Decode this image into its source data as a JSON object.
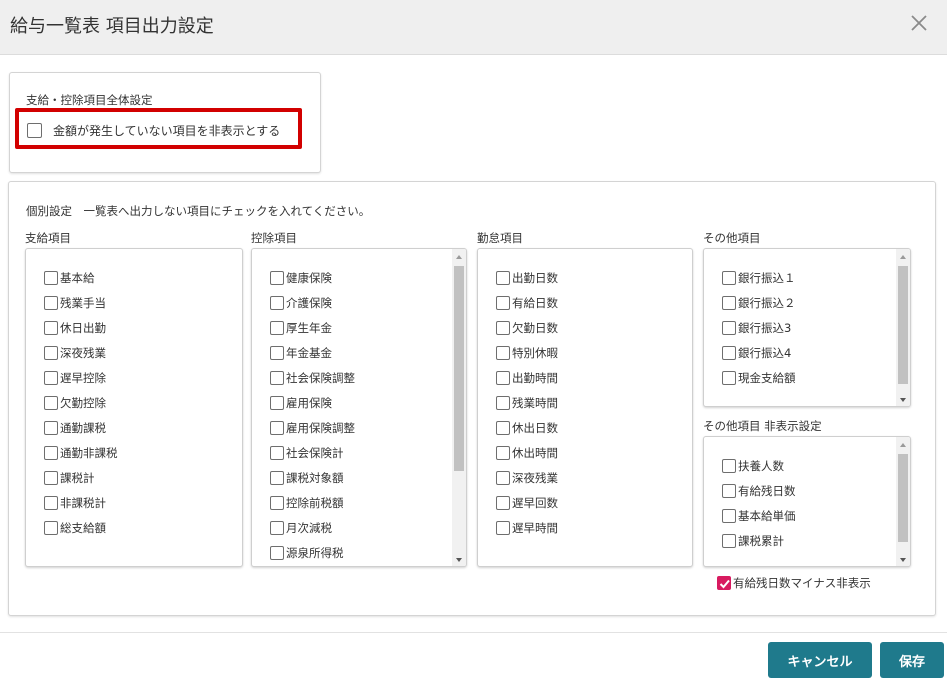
{
  "dialog": {
    "title": "給与一覧表 項目出力設定",
    "close_icon": "close-icon"
  },
  "global_settings": {
    "title": "支給・控除項目全体設定",
    "hide_zero": {
      "label": "金額が発生していない項目を非表示とする",
      "checked": false
    }
  },
  "individual_settings": {
    "title": "個別設定　一覧表へ出力しない項目にチェックを入れてください。",
    "payment": {
      "title": "支給項目",
      "items": [
        {
          "label": "基本給"
        },
        {
          "label": "残業手当"
        },
        {
          "label": "休日出勤"
        },
        {
          "label": "深夜残業"
        },
        {
          "label": "遅早控除"
        },
        {
          "label": "欠勤控除"
        },
        {
          "label": "通勤課税"
        },
        {
          "label": "通勤非課税"
        },
        {
          "label": "課税計"
        },
        {
          "label": "非課税計"
        },
        {
          "label": "総支給額"
        }
      ]
    },
    "deduction": {
      "title": "控除項目",
      "items": [
        {
          "label": "健康保険"
        },
        {
          "label": "介護保険"
        },
        {
          "label": "厚生年金"
        },
        {
          "label": "年金基金"
        },
        {
          "label": "社会保険調整"
        },
        {
          "label": "雇用保険"
        },
        {
          "label": "雇用保険調整"
        },
        {
          "label": "社会保険計"
        },
        {
          "label": "課税対象額"
        },
        {
          "label": "控除前税額"
        },
        {
          "label": "月次減税"
        },
        {
          "label": "源泉所得税"
        }
      ]
    },
    "attendance": {
      "title": "勤怠項目",
      "items": [
        {
          "label": "出勤日数"
        },
        {
          "label": "有給日数"
        },
        {
          "label": "欠勤日数"
        },
        {
          "label": "特別休暇"
        },
        {
          "label": "出勤時間"
        },
        {
          "label": "残業時間"
        },
        {
          "label": "休出日数"
        },
        {
          "label": "休出時間"
        },
        {
          "label": "深夜残業"
        },
        {
          "label": "遅早回数"
        },
        {
          "label": "遅早時間"
        }
      ]
    },
    "other": {
      "title": "その他項目",
      "items": [
        {
          "label": "銀行振込１"
        },
        {
          "label": "銀行振込２"
        },
        {
          "label": "銀行振込3"
        },
        {
          "label": "銀行振込4"
        },
        {
          "label": "現金支給額"
        }
      ]
    },
    "other_hidden": {
      "title": "その他項目 非表示設定",
      "items": [
        {
          "label": "扶養人数"
        },
        {
          "label": "有給残日数"
        },
        {
          "label": "基本給単価"
        },
        {
          "label": "課税累計"
        }
      ]
    },
    "hide_negative_leave": {
      "label": "有給残日数マイナス非表示",
      "checked": true
    }
  },
  "footer": {
    "cancel_label": "キャンセル",
    "save_label": "保存"
  },
  "colors": {
    "accent": "#1f7a8c",
    "checkbox_checked": "#d81b60",
    "highlight": "#d20000"
  }
}
